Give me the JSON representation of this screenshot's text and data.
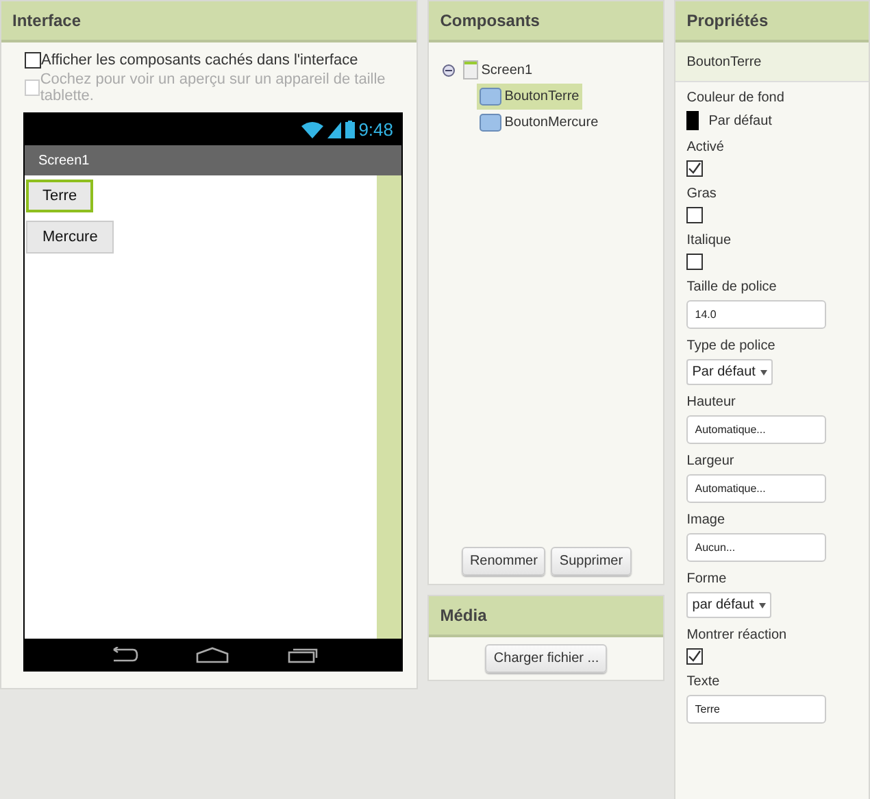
{
  "interface": {
    "title": "Interface",
    "options": [
      {
        "label": "Afficher les composants cachés dans l'interface",
        "checked": false,
        "disabled": false
      },
      {
        "label": "Cochez pour voir un aperçu sur un appareil de taille tablette.",
        "checked": false,
        "disabled": true
      }
    ],
    "phone": {
      "time": "9:48",
      "screen_title": "Screen1",
      "buttons": [
        {
          "label": "Terre",
          "selected": true
        },
        {
          "label": "Mercure",
          "selected": false
        }
      ]
    }
  },
  "components": {
    "title": "Composants",
    "tree": [
      {
        "label": "Screen1",
        "expanded": true,
        "selected": false,
        "children": [
          {
            "label": "BoutonTerre",
            "selected": true
          },
          {
            "label": "BoutonMercure",
            "selected": false
          }
        ]
      }
    ],
    "buttons": [
      "Renommer",
      "Supprimer"
    ]
  },
  "media": {
    "title": "Média",
    "button": "Charger fichier ..."
  },
  "properties": {
    "title": "Propriétés",
    "component": "BoutonTerre",
    "items": [
      {
        "kind": "color",
        "label": "Couleur de fond",
        "value": "Par défaut",
        "color": "#000000"
      },
      {
        "kind": "checkbox",
        "label": "Activé",
        "checked": true
      },
      {
        "kind": "checkbox",
        "label": "Gras",
        "checked": false
      },
      {
        "kind": "checkbox",
        "label": "Italique",
        "checked": false
      },
      {
        "kind": "text",
        "label": "Taille de police",
        "value": "14.0"
      },
      {
        "kind": "select",
        "label": "Type de police",
        "value": "Par défaut"
      },
      {
        "kind": "text",
        "label": "Hauteur",
        "value": "Automatique..."
      },
      {
        "kind": "text",
        "label": "Largeur",
        "value": "Automatique..."
      },
      {
        "kind": "text",
        "label": "Image",
        "value": "Aucun..."
      },
      {
        "kind": "select",
        "label": "Forme",
        "value": "par défaut"
      },
      {
        "kind": "checkbox",
        "label": "Montrer réaction",
        "checked": true
      },
      {
        "kind": "text",
        "label": "Texte",
        "value": "Terre"
      }
    ]
  }
}
